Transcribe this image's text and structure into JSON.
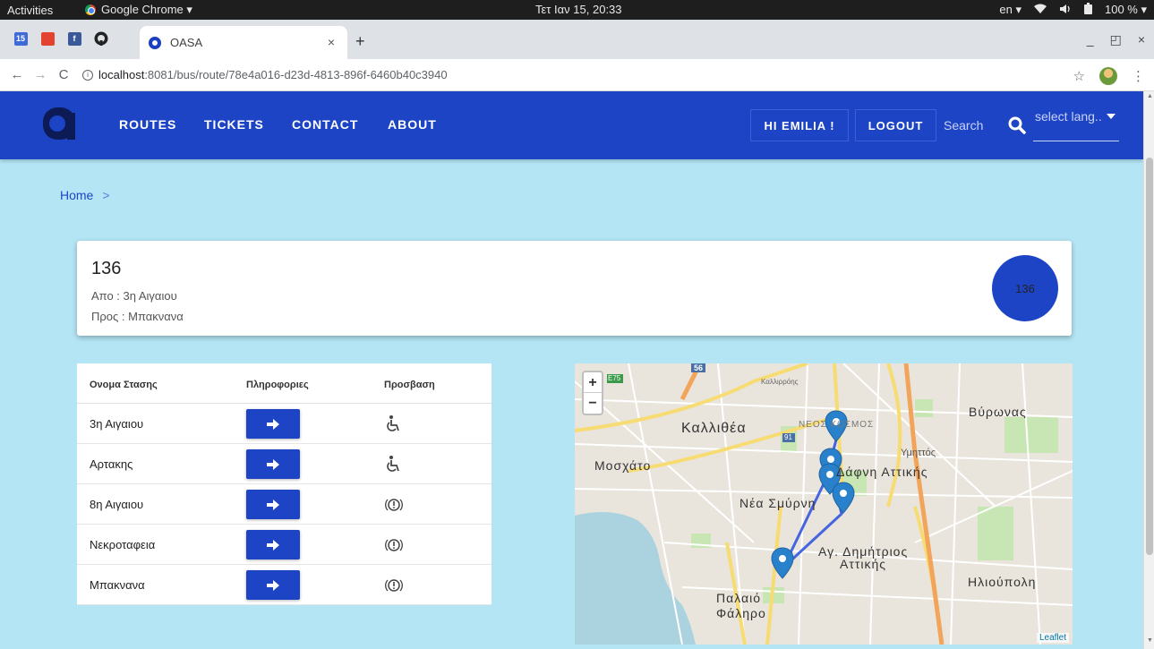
{
  "os_bar": {
    "activities": "Activities",
    "app_name": "Google Chrome ▾",
    "clock": "Τετ Ιαν 15, 20:33",
    "lang": "en ▾",
    "battery": "100 % ▾"
  },
  "browser": {
    "pinned": [
      "15",
      "",
      "f",
      ""
    ],
    "active_tab": "OASA",
    "tab_close": "×",
    "new_tab": "+",
    "url_host": "localhost",
    "url_path": ":8081/bus/route/78e4a016-d23d-4813-896f-6460b40c3940",
    "win_min": "_",
    "win_max": "◰",
    "win_close": "×"
  },
  "nav": {
    "links": [
      "ROUTES",
      "TICKETS",
      "CONTACT",
      "ABOUT"
    ],
    "greeting": "HI EMILIA !",
    "logout": "LOGOUT",
    "search_placeholder": "Search",
    "lang_select": "select lang.."
  },
  "breadcrumb": {
    "home": "Home",
    "sep": ">"
  },
  "route": {
    "number": "136",
    "from": "Απο : 3η Αιγαιου",
    "to": "Προς : Μπακνανα",
    "badge": "136"
  },
  "stops_table": {
    "headers": [
      "Ονομα Στασης",
      "Πληροφοριες",
      "Προσβαση"
    ],
    "rows": [
      {
        "name": "3η Αιγαιου",
        "access": "wheelchair"
      },
      {
        "name": "Αρτακης",
        "access": "wheelchair"
      },
      {
        "name": "8η Αιγαιου",
        "access": "warning"
      },
      {
        "name": "Νεκροταφεια",
        "access": "warning"
      },
      {
        "name": "Μπακνανα",
        "access": "warning"
      }
    ]
  },
  "map": {
    "zoom_in": "+",
    "zoom_out": "−",
    "attribution": "Leaflet",
    "labels": [
      "Καλλιθέα",
      "Μοσχάτο",
      "Νέα Σμύρνη",
      "Δάφνη Αττικής",
      "Βύρωνας",
      "Υμηττός",
      "Αγ. Δημήτριος",
      "Αττικής",
      "Ηλιούπολη",
      "Παλαιό",
      "Φάληρο",
      "ΝΕΟΣ ΚΟΣΜΟΣ",
      "Καλλιρρόης",
      "56",
      "E75",
      "91"
    ]
  },
  "colors": {
    "nav_blue": "#1e44c6",
    "page_bg": "#b3e5f5",
    "marker": "#2a81cb",
    "route_line": "#3355e0"
  }
}
